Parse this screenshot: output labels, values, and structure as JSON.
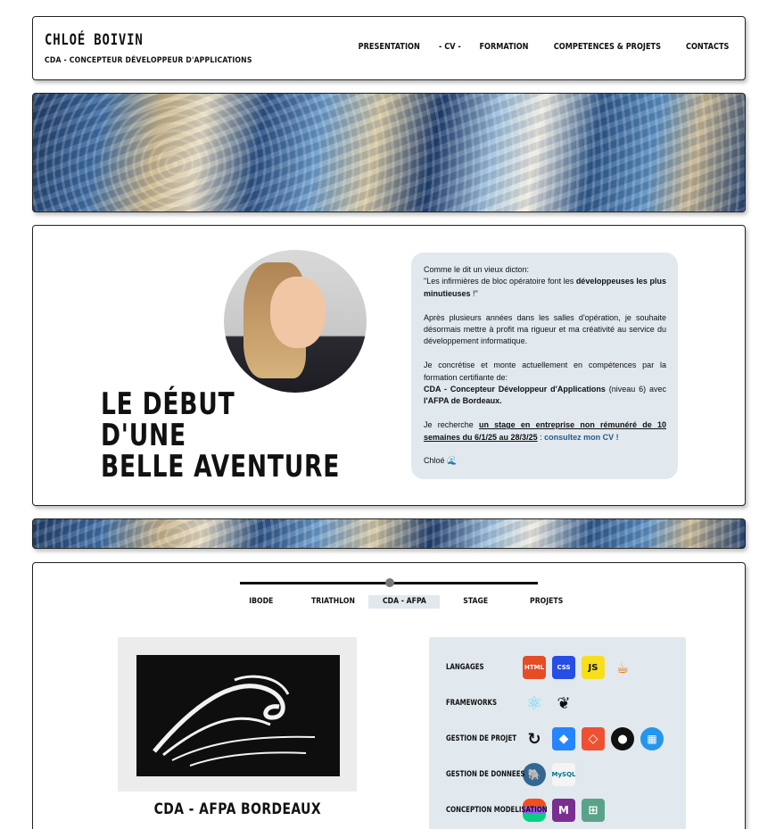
{
  "header": {
    "name": "CHLOÉ BOIVIN",
    "subtitle": "CDA - CONCEPTEUR DÉVELOPPEUR D'APPLICATIONS",
    "nav": [
      "PRESENTATION",
      "- CV -",
      "FORMATION",
      "COMPETENCES & PROJETS",
      "CONTACTS"
    ]
  },
  "hero": {
    "title_lines": [
      "LE DÉBUT",
      "D'UNE",
      "BELLE AVENTURE"
    ],
    "intro": {
      "p1a": "Comme le dit un vieux dicton:",
      "p1b": "\"Les infirmières de bloc opératoire font les ",
      "p1c": "développeuses les plus minutieuses",
      "p1d": " !\"",
      "p2": "Après plusieurs années dans les salles d'opération, je souhaite désormais mettre à profit ma rigueur et ma créativité au service du développement informatique.",
      "p3a": "Je concrétise et monte actuellement en compétences par la formation certifiante de:",
      "p3b": "CDA - Concepteur Développeur d'Applications",
      "p3c": " (niveau 6) avec ",
      "p3d": "l'AFPA de Bordeaux.",
      "p4a": "Je recherche ",
      "p4b": "un stage en entreprise non rémunéré de 10 semaines du 6/1/25 au 28/3/25",
      "p4c": " : ",
      "p4d": "consultez mon CV !",
      "sign": "Chloé 🌊"
    }
  },
  "timeline": {
    "tabs": [
      "IBODE",
      "TRIATHLON",
      "CDA - AFPA",
      "STAGE",
      "PROJETS"
    ],
    "active_index": 2,
    "caption": "CDA - AFPA BORDEAUX",
    "skills": [
      {
        "label": "LANGAGES",
        "icons": [
          "html5-icon",
          "css3-icon",
          "javascript-icon",
          "java-icon"
        ]
      },
      {
        "label": "FRAMEWORKS",
        "icons": [
          "react-icon",
          "spring-icon"
        ]
      },
      {
        "label": "GESTION DE PROJET",
        "icons": [
          "scrum-icon",
          "jira-icon",
          "git-icon",
          "github-icon",
          "docker-icon"
        ]
      },
      {
        "label": "GESTION DE DONNEES",
        "icons": [
          "postgresql-icon",
          "mysql-icon"
        ]
      },
      {
        "label": "CONCEPTION MODELISATION",
        "icons": [
          "figma-icon",
          "uml-icon",
          "merise-icon"
        ]
      }
    ],
    "icon_text": {
      "html": "HTML",
      "css": "CSS",
      "js": "JS",
      "mysql": "MySQL"
    }
  },
  "colors": {
    "panel": "#e1e8ee",
    "text": "#111111",
    "link": "#2a5a88"
  }
}
